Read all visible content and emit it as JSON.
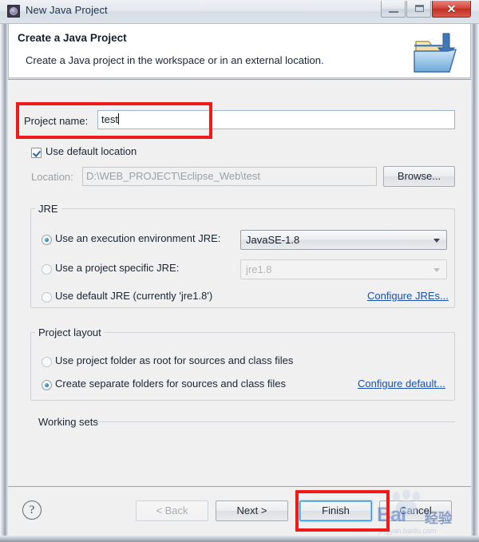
{
  "window": {
    "title": "New Java Project",
    "title_icon": "eclipse-wizard-icon",
    "controls": {
      "minimize": "–",
      "maximize": "□",
      "close": "✕"
    }
  },
  "header": {
    "title": "Create a Java Project",
    "description": "Create a Java project in the workspace or in an external location.",
    "icon": "new-java-project-folder-icon"
  },
  "form": {
    "project_name": {
      "label": "Project name:",
      "value": "test",
      "placeholder": ""
    },
    "use_default_location": {
      "label": "Use default location",
      "checked": true
    },
    "location": {
      "label": "Location:",
      "value": "D:\\WEB_PROJECT\\Eclipse_Web\\test",
      "disabled": true
    },
    "browse_button": "Browse..."
  },
  "jre": {
    "group_label": "JRE",
    "options": [
      {
        "label": "Use an execution environment JRE:",
        "selected": true,
        "combo_value": "JavaSE-1.8",
        "combo_disabled": false
      },
      {
        "label": "Use a project specific JRE:",
        "selected": false,
        "combo_value": "jre1.8",
        "combo_disabled": true
      },
      {
        "label": "Use default JRE (currently 'jre1.8')",
        "selected": false
      }
    ],
    "configure_link": "Configure JREs..."
  },
  "project_layout": {
    "group_label": "Project layout",
    "options": [
      {
        "label": "Use project folder as root for sources and class files",
        "selected": false
      },
      {
        "label": "Create separate folders for sources and class files",
        "selected": true
      }
    ],
    "configure_link": "Configure default..."
  },
  "working_sets": {
    "group_label": "Working sets"
  },
  "buttons": {
    "help": "?",
    "back": "< Back",
    "back_disabled": true,
    "next": "Next >",
    "next_disabled": false,
    "finish": "Finish",
    "finish_focused": true,
    "cancel": "Cancel"
  },
  "annotations": {
    "highlight_project_name": "red-rectangle",
    "highlight_finish": "red-rectangle",
    "color": "#ee1b1b"
  },
  "watermark": {
    "brand": "Bai",
    "cn": "经验",
    "url": "jingyan.baidu.com"
  },
  "colors": {
    "accent": "#1a4fb5",
    "annotation": "#ee1b1b",
    "panel": "#f0f0f0",
    "close_button": "#c03124"
  }
}
